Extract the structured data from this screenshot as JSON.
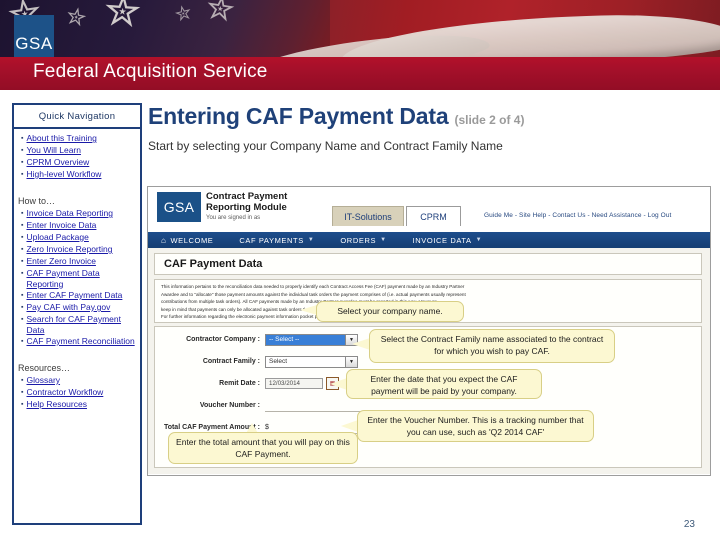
{
  "brand": {
    "logo_text": "GSA",
    "banner_title": "Federal Acquisition Service"
  },
  "sidebar": {
    "header": "Quick Navigation",
    "groups": [
      {
        "label": "",
        "items": [
          "About this Training",
          "You Will Learn",
          "CPRM Overview",
          "High-level Workflow"
        ]
      },
      {
        "label": "How to…",
        "items": [
          "Invoice Data Reporting",
          "Enter Invoice Data",
          "Upload Package",
          "Zero Invoice Reporting",
          "Enter Zero Invoice",
          "CAF Payment Data Reporting",
          "Enter CAF Payment Data",
          "Pay CAF with Pay.gov",
          "Search for CAF Payment Data",
          "CAF Payment Reconciliation"
        ]
      },
      {
        "label": "Resources…",
        "items": [
          "Glossary",
          "Contractor Workflow",
          "Help Resources"
        ]
      }
    ]
  },
  "main": {
    "title": "Entering CAF Payment Data",
    "slide_count": "(slide 2 of 4)",
    "subtitle": "Start by selecting your Company Name and Contract Family Name",
    "page_number": "23"
  },
  "screenshot": {
    "app_logo": "GSA",
    "app_title_line1": "Contract Payment",
    "app_title_line2": "Reporting Module",
    "signed_in_as": "You are signed in as",
    "tabs": [
      "IT-Solutions",
      "CPRM"
    ],
    "utility_links": "Guide Me - Site Help - Contact Us - Need Assistance - Log Out",
    "nav": [
      {
        "label": "WELCOME",
        "icon": "home-icon",
        "caret": false
      },
      {
        "label": "CAF PAYMENTS",
        "icon": "",
        "caret": true
      },
      {
        "label": "ORDERS",
        "icon": "",
        "caret": true
      },
      {
        "label": "INVOICE DATA",
        "icon": "",
        "caret": true
      }
    ],
    "panel_title": "CAF Payment Data",
    "paragraph_line1": "This information pertains to the reconciliation data needed to properly identify each Contract Access Fee (CAF) payment made by an Industry Partner",
    "paragraph_line2": "Awardee and to \"allocate\" those payment amounts against the individual task orders the payment comprises of (i.e. actual payments usually represent",
    "paragraph_line3": "contributions from multiple task orders). All CAF payments made by an Industry Partner Awardee must be reported in this way. However,",
    "paragraph_line4": "keep in mind that payments can only be allocated against task orders that have been reported in this system.",
    "paragraph_line5": "For further information regarding the electronic payment information pocket please click here.",
    "paragraph_link": "click here.",
    "form": {
      "fields": [
        {
          "label": "Contractor Company :",
          "value": "-- Select --",
          "type": "select-highlighted"
        },
        {
          "label": "Contract Family :",
          "value": "Select",
          "type": "select"
        },
        {
          "label": "Remit Date :",
          "value": "12/03/2014",
          "type": "date"
        },
        {
          "label": "Voucher Number :",
          "value": "",
          "type": "text"
        },
        {
          "label": "Total CAF Payment Amount :",
          "value": "",
          "type": "currency",
          "prefix": "$"
        }
      ]
    }
  },
  "callouts": {
    "company": "Select your company name.",
    "family": "Select the Contract Family name associated to the contract for which you wish to pay CAF.",
    "date": "Enter the date that you expect the CAF payment will be paid  by your company.",
    "voucher": "Enter the Voucher Number. This is a tracking number that you can use, such as 'Q2 2014 CAF'",
    "total": "Enter the total amount that you will pay on this CAF Payment."
  },
  "colors": {
    "brand_blue": "#1d5288",
    "banner_red": "#a4102a",
    "heading_blue": "#1f4179",
    "link_blue": "#1a1aa8",
    "callout_yellow": "#fcf8d2"
  }
}
